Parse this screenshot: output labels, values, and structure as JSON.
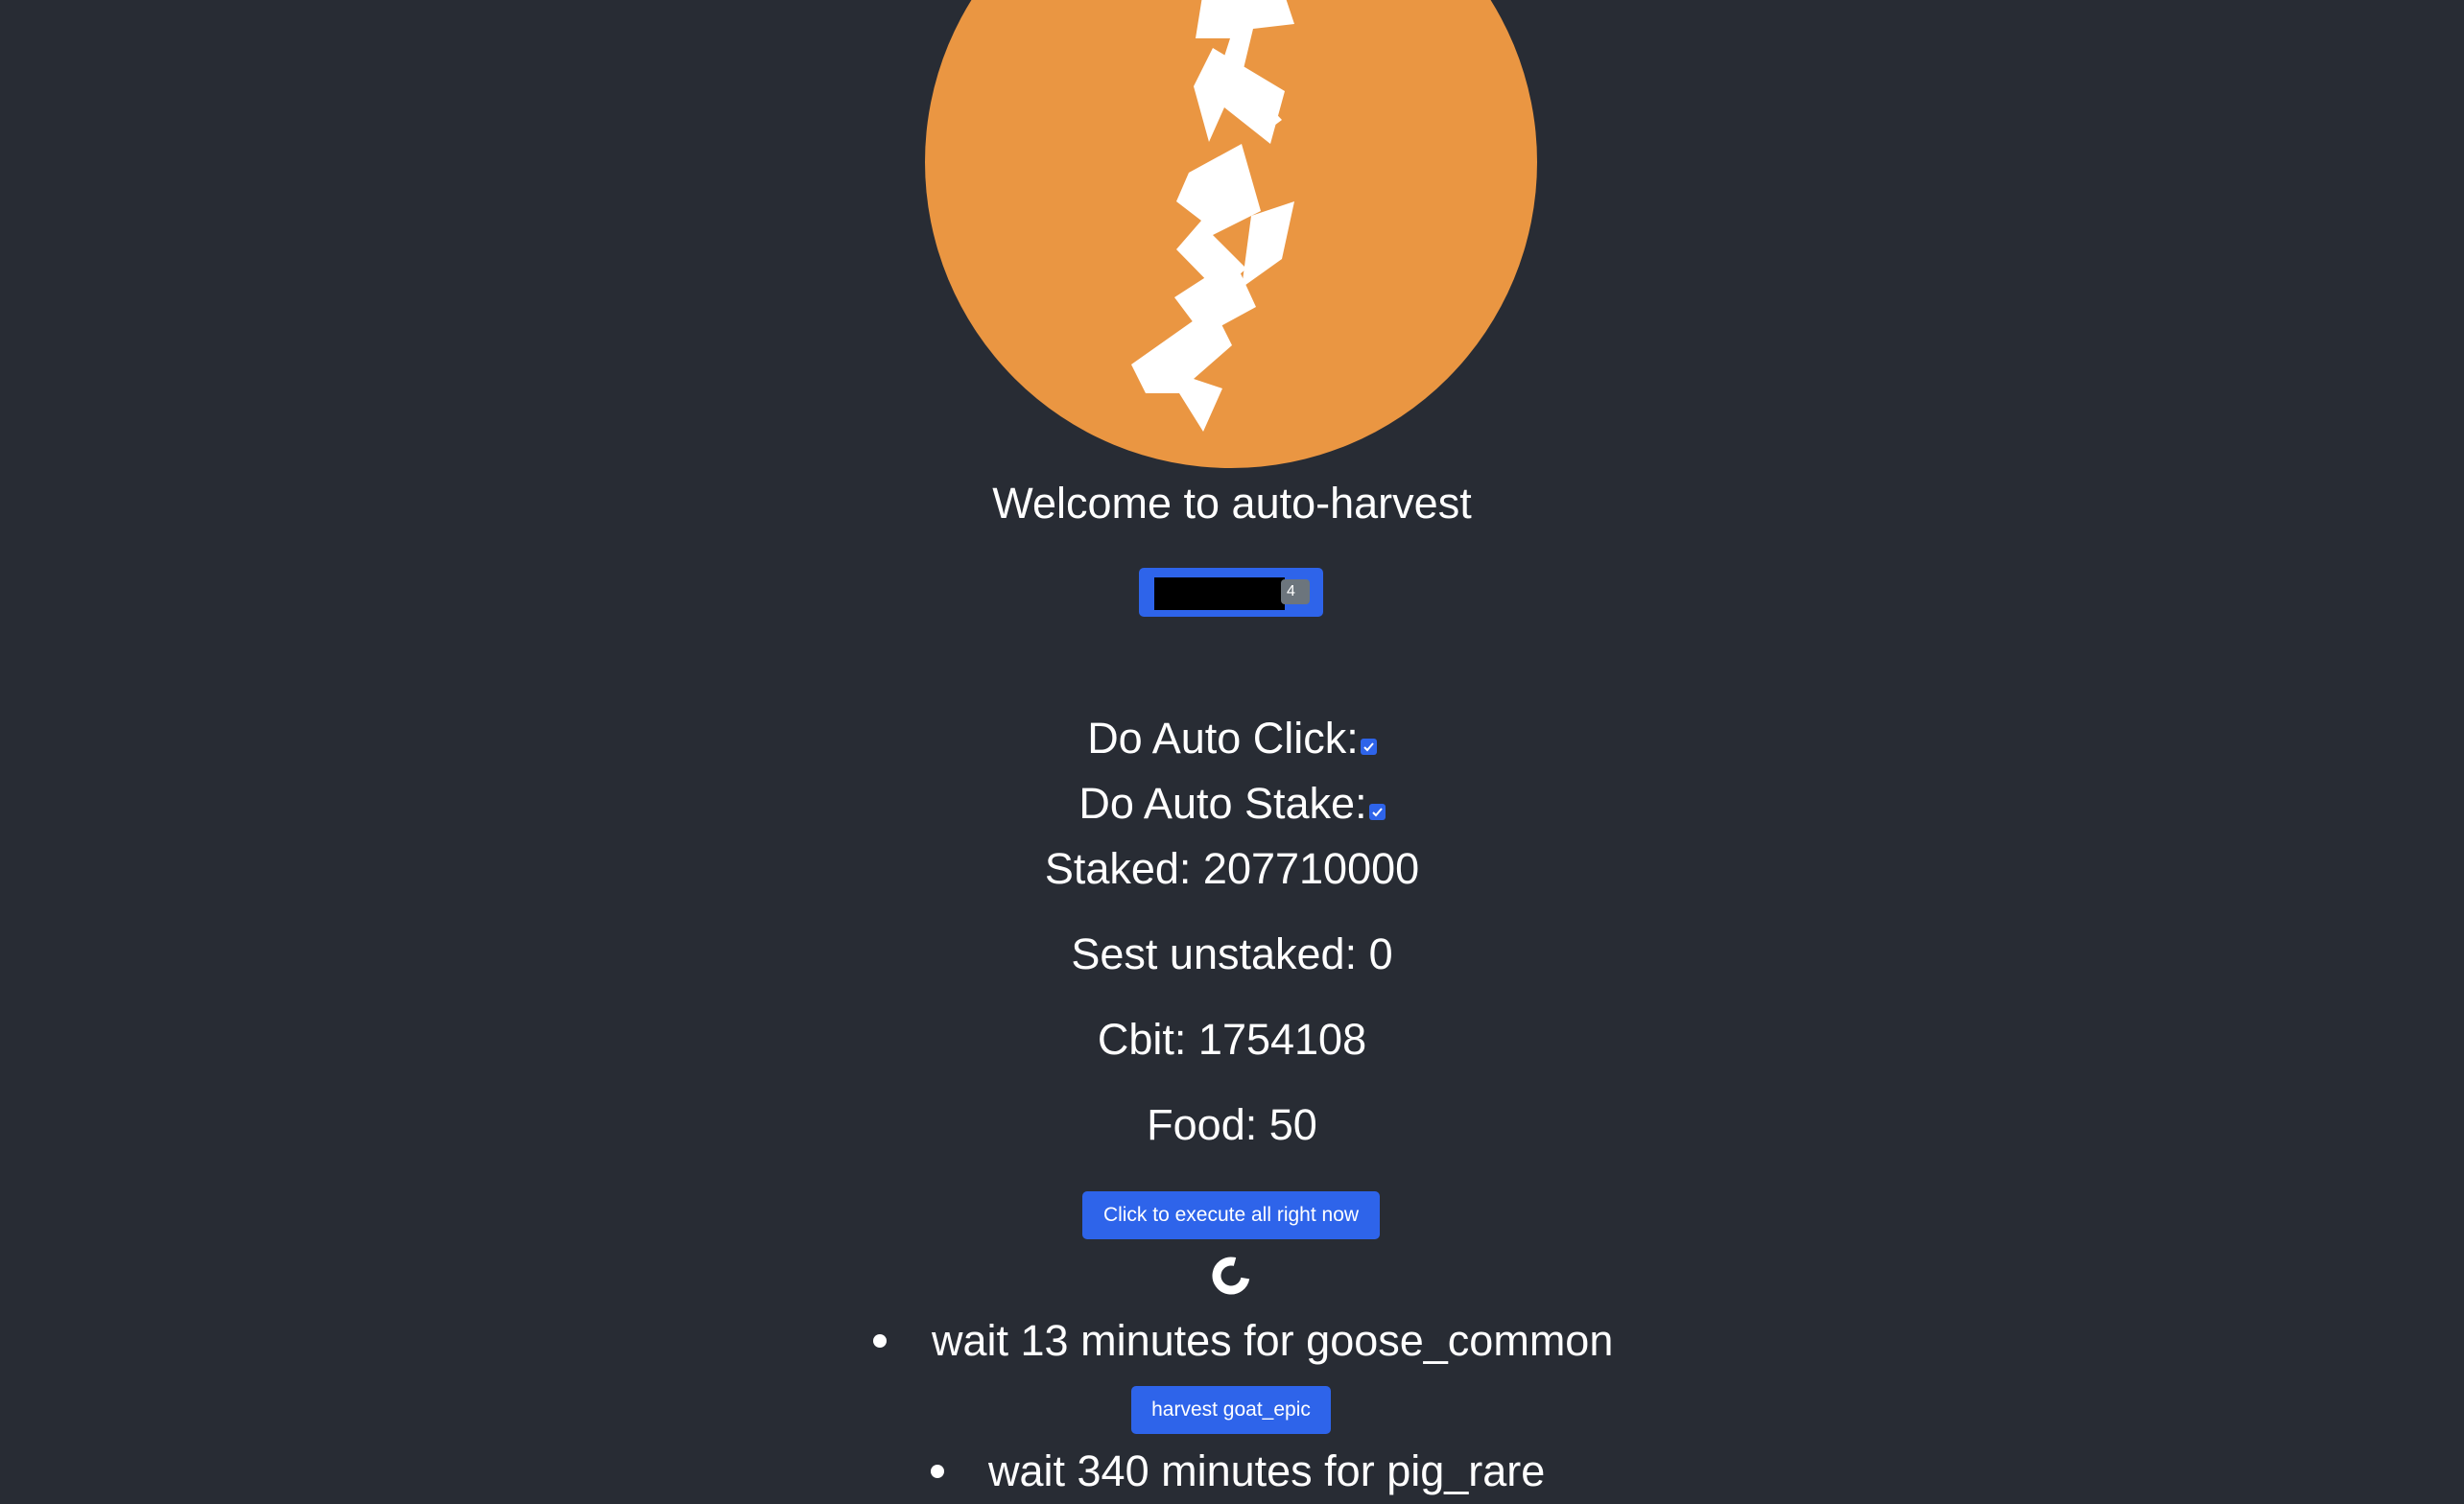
{
  "header": {
    "logo": "wax-logo",
    "welcome_text": "Welcome to auto-harvest"
  },
  "account": {
    "badge": "4"
  },
  "settings": {
    "auto_click_label": "Do Auto Click:",
    "auto_click_checked": true,
    "auto_stake_label": "Do Auto Stake:",
    "auto_stake_checked": true
  },
  "stats": {
    "staked": "Staked: 207710000",
    "unstaked": "Sest unstaked: 0",
    "cbit": "Cbit: 1754108",
    "food": "Food: 50"
  },
  "actions": {
    "execute_label": "Click to execute all right now",
    "spinner_icon": "spinner-icon"
  },
  "tasks": [
    {
      "text": "wait 13 minutes for goose_common"
    },
    {
      "button_label": "harvest goat_epic"
    },
    {
      "text": "wait 340 minutes for pig_rare"
    }
  ],
  "colors": {
    "background": "#282c34",
    "logo_circle": "#ea9642",
    "button_blue": "#2e64ea",
    "text": "#ffffff"
  }
}
